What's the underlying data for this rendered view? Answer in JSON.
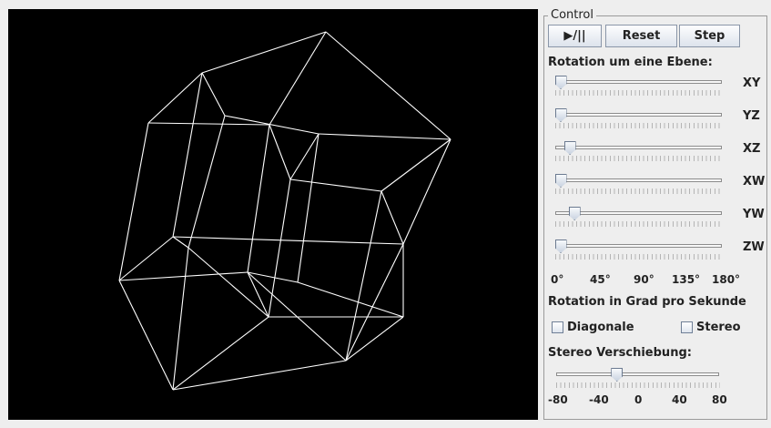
{
  "control": {
    "title": "Control",
    "buttons": {
      "play_pause": "▶/||",
      "reset": "Reset",
      "step": "Step"
    },
    "rotation_heading": "Rotation um eine Ebene:",
    "sliders": [
      {
        "name": "XY",
        "value_deg": 0
      },
      {
        "name": "YZ",
        "value_deg": 0
      },
      {
        "name": "XZ",
        "value_deg": 10
      },
      {
        "name": "XW",
        "value_deg": 0
      },
      {
        "name": "YW",
        "value_deg": 15
      },
      {
        "name": "ZW",
        "value_deg": 0
      }
    ],
    "rotation_scale": [
      "0°",
      "45°",
      "90°",
      "135°",
      "180°"
    ],
    "rotation_unit": "Rotation in Grad pro Sekunde",
    "checkboxes": {
      "diagonale": {
        "label": "Diagonale",
        "checked": false
      },
      "stereo": {
        "label": "Stereo",
        "checked": false
      }
    },
    "stereo": {
      "heading": "Stereo Verschiebung:",
      "value": -20,
      "scale": [
        "-80",
        "-40",
        "0",
        "40",
        "80"
      ]
    }
  },
  "colors": {
    "canvas_background": "#000000",
    "wireframe": "#ffffff",
    "panel_background": "#eeeeee"
  }
}
